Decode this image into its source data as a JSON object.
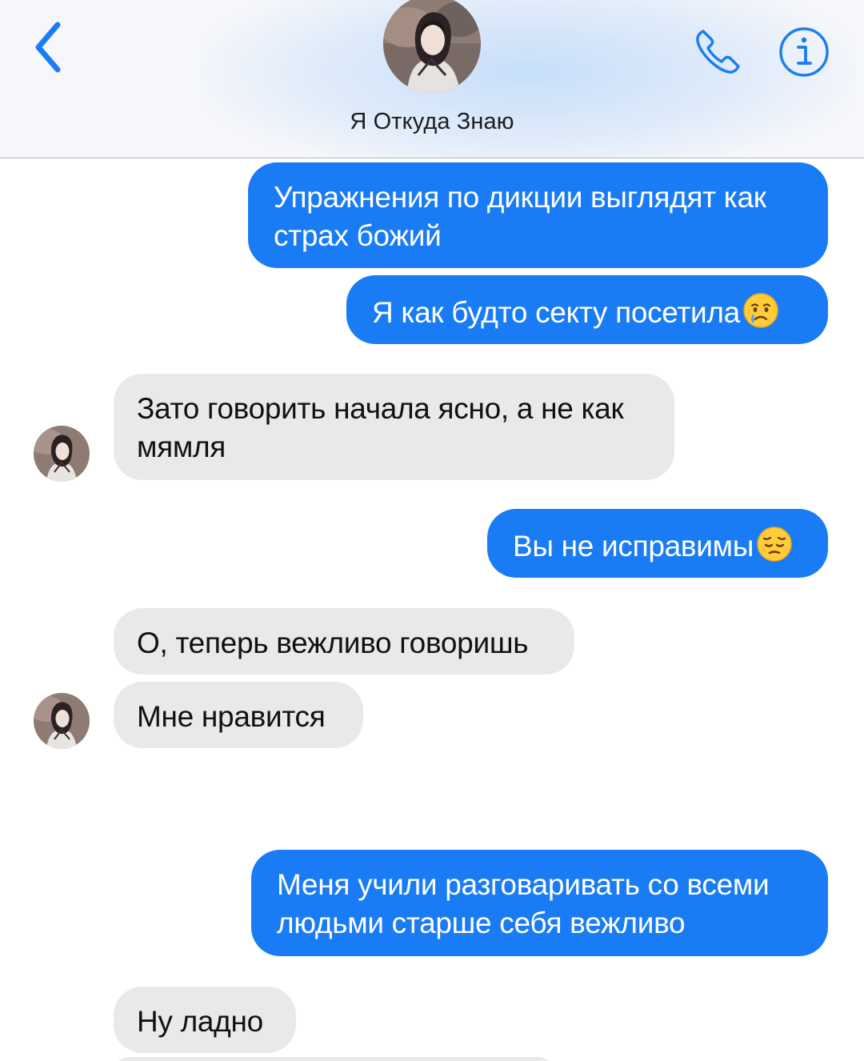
{
  "header": {
    "contact_name": "Я Откуда Знаю",
    "icons": {
      "back": "chevron-left-icon",
      "call": "phone-icon",
      "info": "info-icon"
    },
    "accent_color": "#1a7cf5"
  },
  "messages": [
    {
      "direction": "outgoing",
      "text": "Упражнения по дикции выглядят как страх божий"
    },
    {
      "direction": "outgoing",
      "text": "Я как будто секту посетила",
      "emoji": "crying-face"
    },
    {
      "direction": "incoming",
      "text": "Зато говорить начала ясно, а не как мямля"
    },
    {
      "direction": "outgoing",
      "text": "Вы не исправимы",
      "emoji": "pensive-face"
    },
    {
      "direction": "incoming",
      "text": "О, теперь вежливо говоришь"
    },
    {
      "direction": "incoming",
      "text": "Мне нравится"
    },
    {
      "direction": "outgoing",
      "text": "Меня учили разговаривать со всеми людьми старше себя вежливо"
    },
    {
      "direction": "incoming",
      "text": "Ну ладно"
    }
  ],
  "colors": {
    "outgoing_bubble": "#1a7cf5",
    "incoming_bubble": "#e9e9eb",
    "header_background": "#f6f7fa"
  }
}
